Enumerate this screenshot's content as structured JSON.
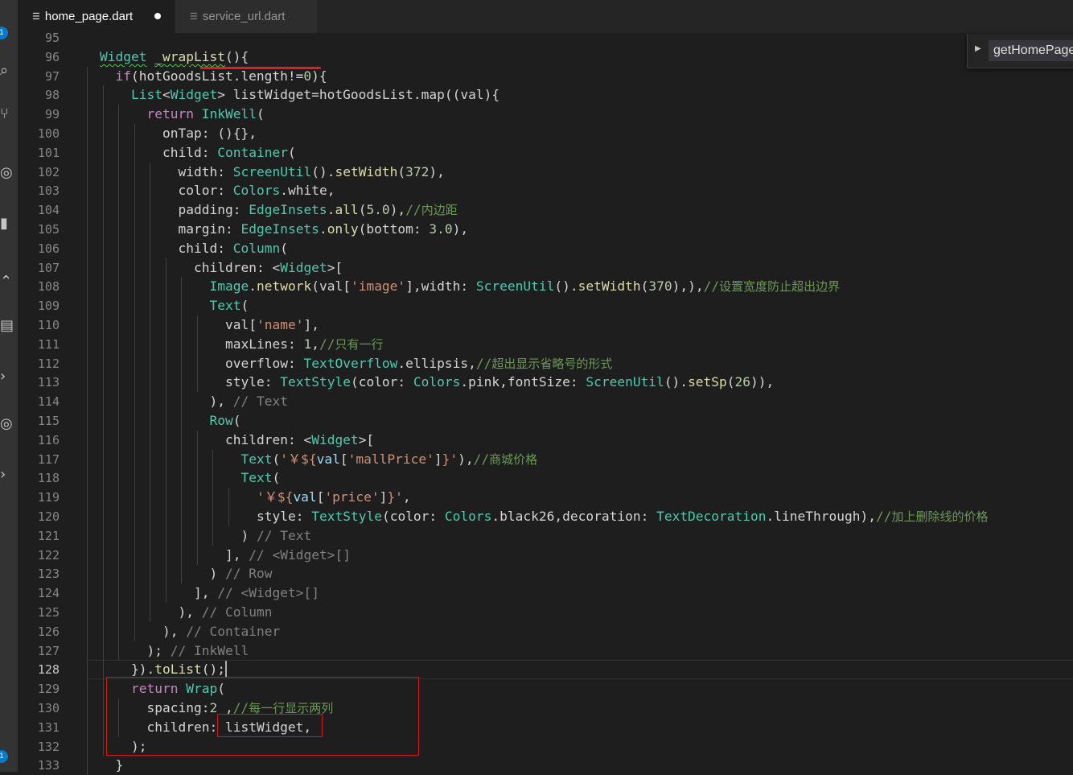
{
  "tabs": [
    {
      "label": "home_page.dart",
      "active": true,
      "modified": true
    },
    {
      "label": "service_url.dart",
      "active": false,
      "modified": false
    }
  ],
  "outline": {
    "item": "getHomePage"
  },
  "activity_badges": [
    "1",
    "1"
  ],
  "editor": {
    "current_line": 128,
    "lines": [
      {
        "n": "95",
        "indent": 0,
        "tokens": []
      },
      {
        "n": "96",
        "indent": 0,
        "tokens": [
          [
            "type squiggle",
            "Widget"
          ],
          [
            "pl",
            " "
          ],
          [
            "fn squiggle",
            "_wrapList"
          ],
          [
            "pl",
            "(){"
          ]
        ]
      },
      {
        "n": "97",
        "indent": 1,
        "tokens": [
          [
            "kw",
            "if"
          ],
          [
            "pl",
            "(hotGoodsList.length!="
          ],
          [
            "num",
            "0"
          ],
          [
            "pl",
            "){"
          ]
        ]
      },
      {
        "n": "98",
        "indent": 2,
        "tokens": [
          [
            "type",
            "List"
          ],
          [
            "pl",
            "<"
          ],
          [
            "type",
            "Widget"
          ],
          [
            "pl",
            "> listWidget=hotGoodsList.map((val){"
          ]
        ]
      },
      {
        "n": "99",
        "indent": 3,
        "tokens": [
          [
            "kw",
            "return"
          ],
          [
            "pl",
            " "
          ],
          [
            "type",
            "InkWell"
          ],
          [
            "pl",
            "("
          ]
        ]
      },
      {
        "n": "100",
        "indent": 4,
        "tokens": [
          [
            "pl",
            "onTap: (){},"
          ]
        ]
      },
      {
        "n": "101",
        "indent": 4,
        "tokens": [
          [
            "pl",
            "child: "
          ],
          [
            "type",
            "Container"
          ],
          [
            "pl",
            "("
          ]
        ]
      },
      {
        "n": "102",
        "indent": 5,
        "tokens": [
          [
            "pl",
            "width: "
          ],
          [
            "type",
            "ScreenUtil"
          ],
          [
            "pl",
            "()."
          ],
          [
            "fn",
            "setWidth"
          ],
          [
            "pl",
            "("
          ],
          [
            "num",
            "372"
          ],
          [
            "pl",
            "),"
          ]
        ]
      },
      {
        "n": "103",
        "indent": 5,
        "tokens": [
          [
            "pl",
            "color: "
          ],
          [
            "type",
            "Colors"
          ],
          [
            "pl",
            ".white,"
          ]
        ]
      },
      {
        "n": "104",
        "indent": 5,
        "tokens": [
          [
            "pl",
            "padding: "
          ],
          [
            "type",
            "EdgeInsets"
          ],
          [
            "pl",
            "."
          ],
          [
            "fn",
            "all"
          ],
          [
            "pl",
            "("
          ],
          [
            "num",
            "5.0"
          ],
          [
            "pl",
            "),"
          ],
          [
            "com",
            "//"
          ],
          [
            "cn",
            "内边距"
          ]
        ]
      },
      {
        "n": "105",
        "indent": 5,
        "tokens": [
          [
            "pl",
            "margin: "
          ],
          [
            "type",
            "EdgeInsets"
          ],
          [
            "pl",
            "."
          ],
          [
            "fn",
            "only"
          ],
          [
            "pl",
            "(bottom: "
          ],
          [
            "num",
            "3.0"
          ],
          [
            "pl",
            "),"
          ]
        ]
      },
      {
        "n": "106",
        "indent": 5,
        "tokens": [
          [
            "pl",
            "child: "
          ],
          [
            "type",
            "Column"
          ],
          [
            "pl",
            "("
          ]
        ]
      },
      {
        "n": "107",
        "indent": 6,
        "tokens": [
          [
            "pl",
            "children: <"
          ],
          [
            "type",
            "Widget"
          ],
          [
            "pl",
            ">["
          ]
        ]
      },
      {
        "n": "108",
        "indent": 7,
        "tokens": [
          [
            "type",
            "Image"
          ],
          [
            "pl",
            "."
          ],
          [
            "fn",
            "network"
          ],
          [
            "pl",
            "(val["
          ],
          [
            "str",
            "'image'"
          ],
          [
            "pl",
            "],width: "
          ],
          [
            "type",
            "ScreenUtil"
          ],
          [
            "pl",
            "()."
          ],
          [
            "fn",
            "setWidth"
          ],
          [
            "pl",
            "("
          ],
          [
            "num",
            "370"
          ],
          [
            "pl",
            "),),"
          ],
          [
            "com",
            "//"
          ],
          [
            "cn",
            "设置宽度防止超出边界"
          ]
        ]
      },
      {
        "n": "109",
        "indent": 7,
        "tokens": [
          [
            "type",
            "Text"
          ],
          [
            "pl",
            "("
          ]
        ]
      },
      {
        "n": "110",
        "indent": 8,
        "tokens": [
          [
            "pl",
            "val["
          ],
          [
            "str",
            "'name'"
          ],
          [
            "pl",
            "],"
          ]
        ]
      },
      {
        "n": "111",
        "indent": 8,
        "tokens": [
          [
            "pl",
            "maxLines: "
          ],
          [
            "num",
            "1"
          ],
          [
            "pl",
            ","
          ],
          [
            "com",
            "//"
          ],
          [
            "cn",
            "只有一行"
          ]
        ]
      },
      {
        "n": "112",
        "indent": 8,
        "tokens": [
          [
            "pl",
            "overflow: "
          ],
          [
            "type",
            "TextOverflow"
          ],
          [
            "pl",
            ".ellipsis,"
          ],
          [
            "com",
            "//"
          ],
          [
            "cn",
            "超出显示省略号的形式"
          ]
        ]
      },
      {
        "n": "113",
        "indent": 8,
        "tokens": [
          [
            "pl",
            "style: "
          ],
          [
            "type",
            "TextStyle"
          ],
          [
            "pl",
            "(color: "
          ],
          [
            "type",
            "Colors"
          ],
          [
            "pl",
            ".pink,fontSize: "
          ],
          [
            "type",
            "ScreenUtil"
          ],
          [
            "pl",
            "()."
          ],
          [
            "fn",
            "setSp"
          ],
          [
            "pl",
            "("
          ],
          [
            "num",
            "26"
          ],
          [
            "pl",
            ")),"
          ]
        ]
      },
      {
        "n": "114",
        "indent": 7,
        "tokens": [
          [
            "pl",
            "), "
          ],
          [
            "hint",
            "// Text"
          ]
        ]
      },
      {
        "n": "115",
        "indent": 7,
        "tokens": [
          [
            "type",
            "Row"
          ],
          [
            "pl",
            "("
          ]
        ]
      },
      {
        "n": "116",
        "indent": 8,
        "tokens": [
          [
            "pl",
            "children: <"
          ],
          [
            "type",
            "Widget"
          ],
          [
            "pl",
            ">["
          ]
        ]
      },
      {
        "n": "117",
        "indent": 9,
        "tokens": [
          [
            "type",
            "Text"
          ],
          [
            "pl",
            "("
          ],
          [
            "str",
            "'￥${"
          ],
          [
            "var",
            "val"
          ],
          [
            "pl",
            "["
          ],
          [
            "str",
            "'mallPrice'"
          ],
          [
            "pl",
            "]"
          ],
          [
            "str",
            "}'"
          ],
          [
            "pl",
            "),"
          ],
          [
            "com",
            "//"
          ],
          [
            "cn",
            "商城价格"
          ]
        ]
      },
      {
        "n": "118",
        "indent": 9,
        "tokens": [
          [
            "type",
            "Text"
          ],
          [
            "pl",
            "("
          ]
        ]
      },
      {
        "n": "119",
        "indent": 10,
        "tokens": [
          [
            "str",
            "'￥${"
          ],
          [
            "var",
            "val"
          ],
          [
            "pl",
            "["
          ],
          [
            "str",
            "'price'"
          ],
          [
            "pl",
            "]"
          ],
          [
            "str",
            "}'"
          ],
          [
            "pl",
            ","
          ]
        ]
      },
      {
        "n": "120",
        "indent": 10,
        "tokens": [
          [
            "pl",
            "style: "
          ],
          [
            "type",
            "TextStyle"
          ],
          [
            "pl",
            "(color: "
          ],
          [
            "type",
            "Colors"
          ],
          [
            "pl",
            ".black26,decoration: "
          ],
          [
            "type",
            "TextDecoration"
          ],
          [
            "pl",
            ".lineThrough),"
          ],
          [
            "com",
            "//"
          ],
          [
            "cn",
            "加上删除线的价格"
          ]
        ]
      },
      {
        "n": "121",
        "indent": 9,
        "tokens": [
          [
            "pl",
            ") "
          ],
          [
            "hint",
            "// Text"
          ]
        ]
      },
      {
        "n": "122",
        "indent": 8,
        "tokens": [
          [
            "pl",
            "], "
          ],
          [
            "hint",
            "// <Widget>[]"
          ]
        ]
      },
      {
        "n": "123",
        "indent": 7,
        "tokens": [
          [
            "pl",
            ") "
          ],
          [
            "hint",
            "// Row"
          ]
        ]
      },
      {
        "n": "124",
        "indent": 6,
        "tokens": [
          [
            "pl",
            "], "
          ],
          [
            "hint",
            "// <Widget>[]"
          ]
        ]
      },
      {
        "n": "125",
        "indent": 5,
        "tokens": [
          [
            "pl",
            "), "
          ],
          [
            "hint",
            "// Column"
          ]
        ]
      },
      {
        "n": "126",
        "indent": 4,
        "tokens": [
          [
            "pl",
            "), "
          ],
          [
            "hint",
            "// Container"
          ]
        ]
      },
      {
        "n": "127",
        "indent": 3,
        "tokens": [
          [
            "pl",
            "); "
          ],
          [
            "hint",
            "// InkWell"
          ]
        ]
      },
      {
        "n": "128",
        "indent": 2,
        "tokens": [
          [
            "pl",
            "})."
          ],
          [
            "fn",
            "toList"
          ],
          [
            "pl",
            "();"
          ]
        ]
      },
      {
        "n": "129",
        "indent": 2,
        "tokens": [
          [
            "kw",
            "return"
          ],
          [
            "pl",
            " "
          ],
          [
            "type",
            "Wrap"
          ],
          [
            "pl",
            "("
          ]
        ]
      },
      {
        "n": "130",
        "indent": 3,
        "tokens": [
          [
            "pl",
            "spacing:"
          ],
          [
            "num",
            "2"
          ],
          [
            "pl",
            " ,"
          ],
          [
            "com",
            "//"
          ],
          [
            "cn",
            "每一行显示两列"
          ]
        ]
      },
      {
        "n": "131",
        "indent": 3,
        "tokens": [
          [
            "pl",
            "children: listWidget,"
          ]
        ]
      },
      {
        "n": "132",
        "indent": 2,
        "tokens": [
          [
            "pl",
            ");"
          ]
        ]
      },
      {
        "n": "133",
        "indent": 1,
        "tokens": [
          [
            "pl",
            "}"
          ]
        ]
      }
    ]
  }
}
